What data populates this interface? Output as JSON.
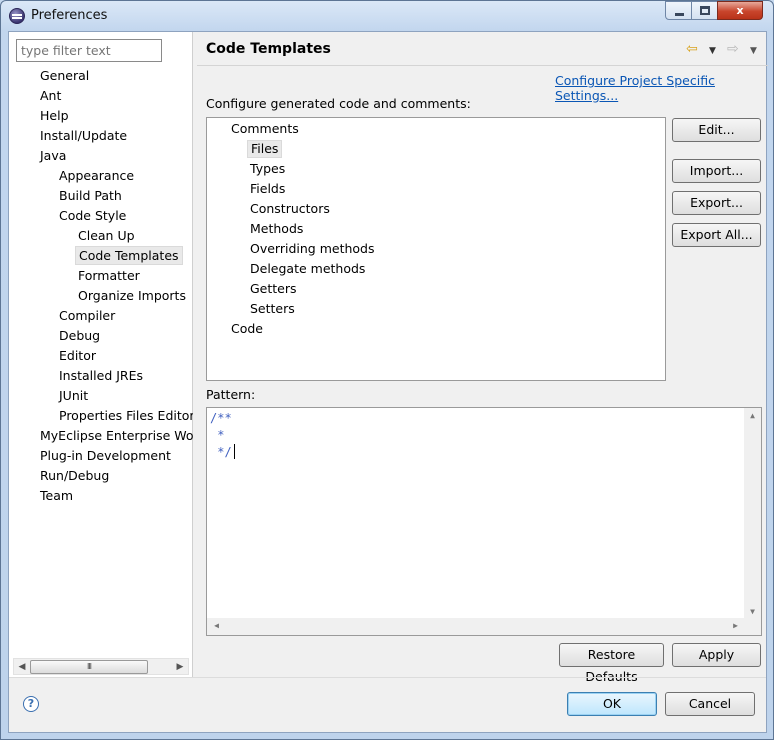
{
  "window": {
    "title": "Preferences",
    "controls": {
      "minimize": "",
      "maximize": "",
      "close": "x"
    }
  },
  "sidebar": {
    "filter_placeholder": "type filter text",
    "items": [
      {
        "label": "General",
        "level": 0
      },
      {
        "label": "Ant",
        "level": 0
      },
      {
        "label": "Help",
        "level": 0
      },
      {
        "label": "Install/Update",
        "level": 0
      },
      {
        "label": "Java",
        "level": 0
      },
      {
        "label": "Appearance",
        "level": 1
      },
      {
        "label": "Build Path",
        "level": 1
      },
      {
        "label": "Code Style",
        "level": 1
      },
      {
        "label": "Clean Up",
        "level": 2
      },
      {
        "label": "Code Templates",
        "level": 2,
        "selected": true
      },
      {
        "label": "Formatter",
        "level": 2
      },
      {
        "label": "Organize Imports",
        "level": 2
      },
      {
        "label": "Compiler",
        "level": 1
      },
      {
        "label": "Debug",
        "level": 1
      },
      {
        "label": "Editor",
        "level": 1
      },
      {
        "label": "Installed JREs",
        "level": 1
      },
      {
        "label": "JUnit",
        "level": 1
      },
      {
        "label": "Properties Files Editor",
        "level": 1
      },
      {
        "label": "MyEclipse Enterprise Workbench",
        "level": 0
      },
      {
        "label": "Plug-in Development",
        "level": 0
      },
      {
        "label": "Run/Debug",
        "level": 0
      },
      {
        "label": "Team",
        "level": 0
      }
    ],
    "scroll_left": "◀",
    "scroll_right": "▶",
    "scroll_grip": "III"
  },
  "header": {
    "title": "Code Templates",
    "back_icon": "⇦",
    "forward_icon": "⇨",
    "menu_icon": "▼"
  },
  "main": {
    "config_link": "Configure Project Specific Settings...",
    "section_label": "Configure generated code and comments:",
    "templates": [
      {
        "label": "Comments",
        "level": 0
      },
      {
        "label": "Files",
        "level": 1,
        "selected": true
      },
      {
        "label": "Types",
        "level": 1
      },
      {
        "label": "Fields",
        "level": 1
      },
      {
        "label": "Constructors",
        "level": 1
      },
      {
        "label": "Methods",
        "level": 1
      },
      {
        "label": "Overriding methods",
        "level": 1
      },
      {
        "label": "Delegate methods",
        "level": 1
      },
      {
        "label": "Getters",
        "level": 1
      },
      {
        "label": "Setters",
        "level": 1
      },
      {
        "label": "Code",
        "level": 0
      }
    ],
    "buttons": {
      "edit": "Edit...",
      "import": "Import...",
      "export": "Export...",
      "export_all": "Export All..."
    },
    "pattern_label": "Pattern:",
    "pattern_lines": [
      "/**",
      " *",
      " */"
    ],
    "scroll_up": "▲",
    "scroll_down": "▼",
    "scroll_left": "◀",
    "scroll_right": "▶"
  },
  "footer": {
    "restore_defaults": "Restore Defaults",
    "apply": "Apply",
    "ok": "OK",
    "cancel": "Cancel",
    "help_icon": "?"
  }
}
